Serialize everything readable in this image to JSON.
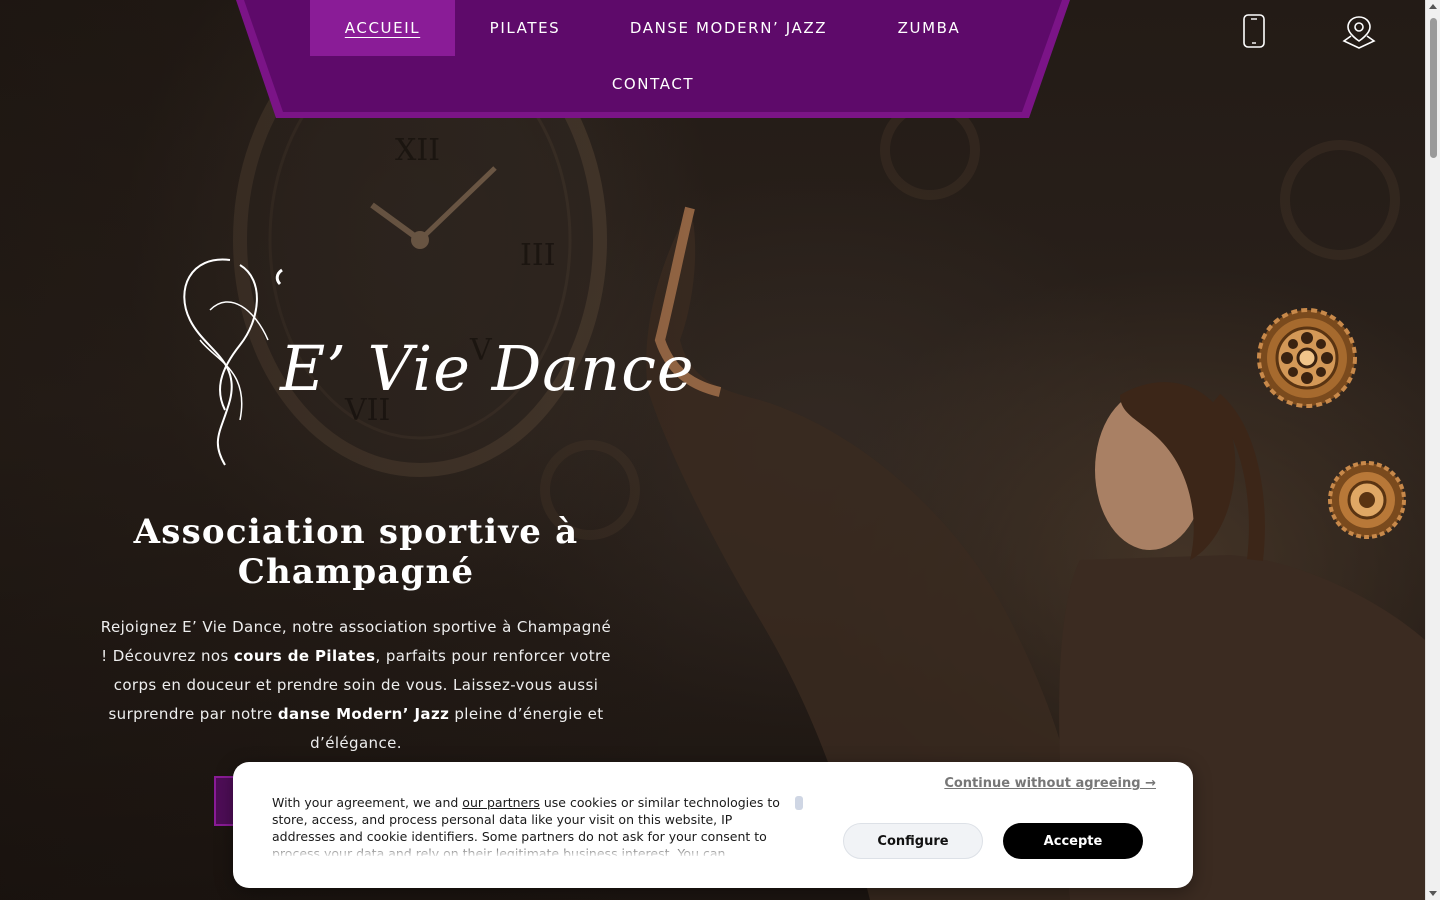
{
  "nav": {
    "items": [
      {
        "label": "ACCUEIL",
        "active": true
      },
      {
        "label": "PILATES"
      },
      {
        "label": "DANSE MODERN’ JAZZ"
      },
      {
        "label": "ZUMBA"
      },
      {
        "label": "CONTACT"
      }
    ],
    "phone_icon": "mobile-phone-icon",
    "location_icon": "map-pin-icon",
    "bar_color": "#5e0a6a",
    "active_color": "#8a1c97"
  },
  "logo": {
    "text": "E’ Vie Dance"
  },
  "hero": {
    "title": "Association sportive à Champagné",
    "intro_parts": {
      "p1": "Rejoignez E’ Vie Dance, notre association sportive à Champagné ! Découvrez nos ",
      "b1": "cours de Pilates",
      "p2": ", parfaits pour renforcer votre corps en douceur et prendre soin de vous. Laissez-vous aussi surprendre par notre ",
      "b2": "danse Modern’ Jazz",
      "p3": " pleine d’énergie et d’élégance."
    }
  },
  "cookie": {
    "text_before_link": "With your agreement, we and ",
    "link": "our partners",
    "text_after_link": " use cookies or similar technologies to store, access, and process personal data like your visit on this website, IP addresses and cookie identifiers. Some partners do not ask for your consent to process your data and rely on their legitimate business interest. You can",
    "continue": "Continue without agreeing →",
    "configure": "Configure",
    "accept": "Accepte"
  }
}
